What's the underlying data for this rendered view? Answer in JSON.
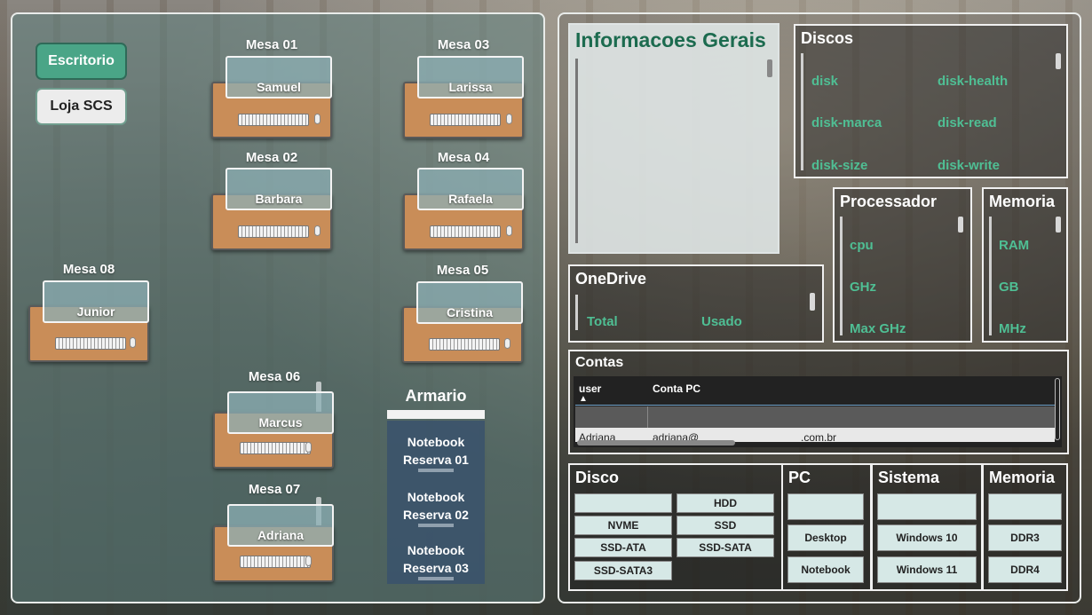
{
  "nav": {
    "escritorio": "Escritorio",
    "loja": "Loja SCS"
  },
  "desks": [
    {
      "title": "Mesa 01",
      "user": "Samuel"
    },
    {
      "title": "Mesa 03",
      "user": "Larissa"
    },
    {
      "title": "Mesa 02",
      "user": "Barbara"
    },
    {
      "title": "Mesa 04",
      "user": "Rafaela"
    },
    {
      "title": "Mesa 08",
      "user": "Junior"
    },
    {
      "title": "Mesa 05",
      "user": "Cristina"
    },
    {
      "title": "Mesa 06",
      "user": "Marcus"
    },
    {
      "title": "Mesa 07",
      "user": "Adriana"
    }
  ],
  "armario": {
    "title": "Armario",
    "slots": [
      {
        "line1": "Notebook",
        "line2": "Reserva 01"
      },
      {
        "line1": "Notebook",
        "line2": "Reserva 02"
      },
      {
        "line1": "Notebook",
        "line2": "Reserva 03"
      }
    ]
  },
  "info": {
    "title": "Informacoes Gerais"
  },
  "discos": {
    "title": "Discos",
    "fields": [
      "disk",
      "disk-health",
      "disk-marca",
      "disk-read",
      "disk-size",
      "disk-write"
    ]
  },
  "onedrive": {
    "title": "OneDrive",
    "fields": [
      "Total",
      "Usado"
    ]
  },
  "processador": {
    "title": "Processador",
    "fields": [
      "cpu",
      "GHz",
      "Max GHz"
    ]
  },
  "memoria_info": {
    "title": "Memoria",
    "fields": [
      "RAM",
      "GB",
      "MHz"
    ]
  },
  "contas": {
    "title": "Contas",
    "columns": [
      "user",
      "Conta PC"
    ],
    "partial_row": [
      "Adriana",
      "adriana@",
      ".com.br"
    ]
  },
  "filters": {
    "disco": {
      "title": "Disco",
      "options": [
        "",
        "HDD",
        "NVME",
        "SSD",
        "SSD-ATA",
        "SSD-SATA",
        "SSD-SATA3"
      ]
    },
    "pc": {
      "title": "PC",
      "options": [
        "",
        "Desktop",
        "Notebook"
      ]
    },
    "sistema": {
      "title": "Sistema",
      "options": [
        "",
        "Windows 10",
        "Windows 11"
      ]
    },
    "memoria": {
      "title": "Memoria",
      "options": [
        "",
        "DDR3",
        "DDR4"
      ]
    }
  },
  "colors": {
    "accent": "#4aa587",
    "desk": "#c98d58",
    "field_text": "#4fbf94"
  }
}
